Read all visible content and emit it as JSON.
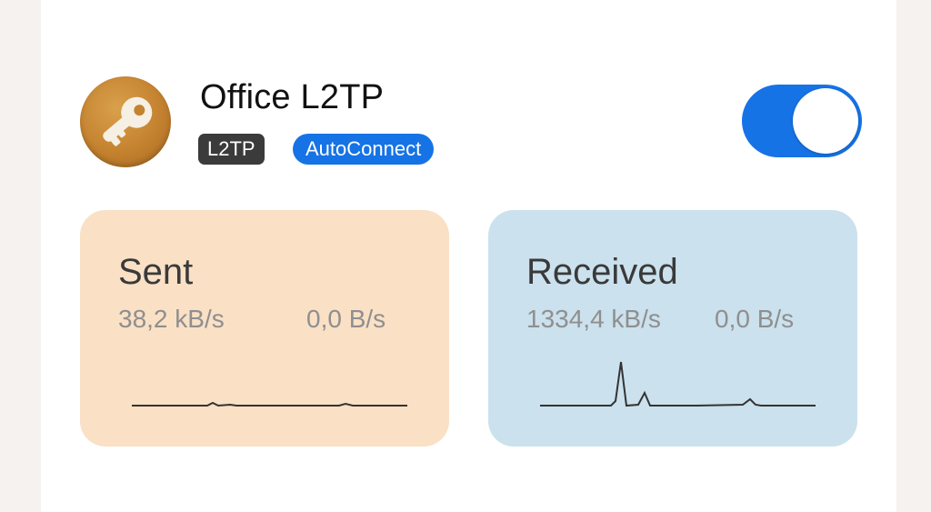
{
  "connection": {
    "name": "Office L2TP",
    "type_badge": "L2TP",
    "autoconnect_badge": "AutoConnect",
    "enabled": true
  },
  "stats": {
    "sent": {
      "label": "Sent",
      "rate_primary": "38,2 kB/s",
      "rate_secondary": "0,0 B/s"
    },
    "received": {
      "label": "Received",
      "rate_primary": "1334,4 kB/s",
      "rate_secondary": "0,0 B/s"
    }
  },
  "colors": {
    "accent": "#1673e6",
    "sent_card": "#fae0c5",
    "received_card": "#cbe1ed",
    "icon": "#c4822f"
  },
  "icons": {
    "app_icon": "key-icon"
  }
}
